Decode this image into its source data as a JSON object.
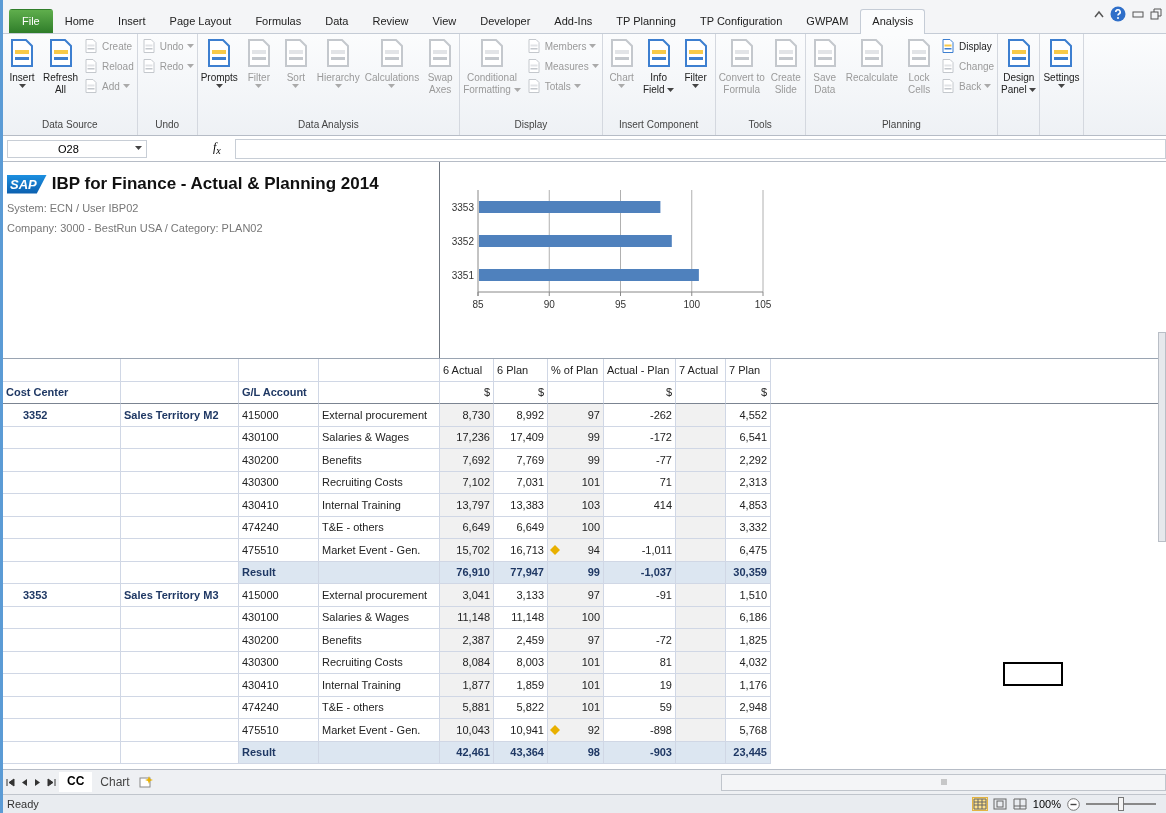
{
  "menu_tabs": [
    {
      "label": "File",
      "kind": "file",
      "selected": false
    },
    {
      "label": "Home",
      "kind": "tab",
      "selected": false
    },
    {
      "label": "Insert",
      "kind": "tab",
      "selected": false
    },
    {
      "label": "Page Layout",
      "kind": "tab",
      "selected": false
    },
    {
      "label": "Formulas",
      "kind": "tab",
      "selected": false
    },
    {
      "label": "Data",
      "kind": "tab",
      "selected": false
    },
    {
      "label": "Review",
      "kind": "tab",
      "selected": false
    },
    {
      "label": "View",
      "kind": "tab",
      "selected": false
    },
    {
      "label": "Developer",
      "kind": "tab",
      "selected": false
    },
    {
      "label": "Add-Ins",
      "kind": "tab",
      "selected": false
    },
    {
      "label": "TP Planning",
      "kind": "tab",
      "selected": false
    },
    {
      "label": "TP Configuration",
      "kind": "tab",
      "selected": false
    },
    {
      "label": "GWPAM",
      "kind": "tab",
      "selected": false
    },
    {
      "label": "Analysis",
      "kind": "tab",
      "selected": true
    }
  ],
  "ribbon": {
    "groups": [
      {
        "label": "Data Source",
        "items": [
          {
            "kind": "large",
            "lines": [
              "Insert"
            ],
            "dropdown": true,
            "disabled": false
          },
          {
            "kind": "large",
            "lines": [
              "Refresh",
              "All"
            ],
            "dropdown": false,
            "disabled": false
          },
          {
            "kind": "stack",
            "items": [
              {
                "label": "Create",
                "dropdown": false,
                "disabled": true
              },
              {
                "label": "Reload",
                "dropdown": false,
                "disabled": true
              },
              {
                "label": "Add",
                "dropdown": true,
                "disabled": true
              }
            ]
          }
        ]
      },
      {
        "label": "Undo",
        "items": [
          {
            "kind": "stack",
            "items": [
              {
                "label": "Undo",
                "dropdown": true,
                "disabled": true
              },
              {
                "label": "Redo",
                "dropdown": true,
                "disabled": true
              }
            ]
          }
        ]
      },
      {
        "label": "Data Analysis",
        "items": [
          {
            "kind": "large",
            "lines": [
              "Prompts"
            ],
            "dropdown": true,
            "disabled": false
          },
          {
            "kind": "large",
            "lines": [
              "Filter"
            ],
            "dropdown": true,
            "disabled": true
          },
          {
            "kind": "large",
            "lines": [
              "Sort"
            ],
            "dropdown": true,
            "disabled": true
          },
          {
            "kind": "large",
            "lines": [
              "Hierarchy"
            ],
            "dropdown": true,
            "disabled": true
          },
          {
            "kind": "large",
            "lines": [
              "Calculations"
            ],
            "dropdown": true,
            "disabled": true
          },
          {
            "kind": "large",
            "lines": [
              "Swap",
              "Axes"
            ],
            "dropdown": false,
            "disabled": true
          }
        ]
      },
      {
        "label": "Display",
        "items": [
          {
            "kind": "large",
            "lines": [
              "Conditional",
              "Formatting"
            ],
            "dropdown": true,
            "disabled": true
          },
          {
            "kind": "stack",
            "items": [
              {
                "label": "Members",
                "dropdown": true,
                "disabled": true
              },
              {
                "label": "Measures",
                "dropdown": true,
                "disabled": true
              },
              {
                "label": "Totals",
                "dropdown": true,
                "disabled": true
              }
            ]
          }
        ]
      },
      {
        "label": "Insert Component",
        "items": [
          {
            "kind": "large",
            "lines": [
              "Chart"
            ],
            "dropdown": true,
            "disabled": true
          },
          {
            "kind": "large",
            "lines": [
              "Info",
              "Field"
            ],
            "dropdown": true,
            "disabled": false
          },
          {
            "kind": "large",
            "lines": [
              "Filter"
            ],
            "dropdown": true,
            "disabled": false
          }
        ]
      },
      {
        "label": "Tools",
        "items": [
          {
            "kind": "large",
            "lines": [
              "Convert to",
              "Formula"
            ],
            "dropdown": false,
            "disabled": true
          },
          {
            "kind": "large",
            "lines": [
              "Create",
              "Slide"
            ],
            "dropdown": false,
            "disabled": true
          }
        ]
      },
      {
        "label": "Planning",
        "items": [
          {
            "kind": "large",
            "lines": [
              "Save",
              "Data"
            ],
            "dropdown": false,
            "disabled": true
          },
          {
            "kind": "large",
            "lines": [
              "Recalculate"
            ],
            "dropdown": false,
            "disabled": true
          },
          {
            "kind": "large",
            "lines": [
              "Lock",
              "Cells"
            ],
            "dropdown": false,
            "disabled": true
          },
          {
            "kind": "stack",
            "items": [
              {
                "label": "Display",
                "dropdown": false,
                "disabled": false
              },
              {
                "label": "Change",
                "dropdown": false,
                "disabled": true
              },
              {
                "label": "Back",
                "dropdown": true,
                "disabled": true
              }
            ]
          }
        ]
      },
      {
        "items": [
          {
            "kind": "large",
            "lines": [
              "Design",
              "Panel"
            ],
            "dropdown": true,
            "disabled": false
          }
        ]
      },
      {
        "items": [
          {
            "kind": "large",
            "lines": [
              "Settings"
            ],
            "dropdown": true,
            "disabled": false
          }
        ]
      }
    ]
  },
  "formula_bar": {
    "name_box": "O28",
    "function_label": "f$_{x}$"
  },
  "report": {
    "logo": "SAP",
    "title": "IBP for Finance - Actual & Planning 2014",
    "lines": [
      "System: ECN / User IBP02",
      "Company: 3000 - BestRun USA / Category: PLAN02"
    ],
    "chart_data": {
      "type": "bar",
      "orientation": "horizontal",
      "categories": [
        "3353",
        "3352",
        "3351"
      ],
      "series": [
        {
          "color": "#4f81bd",
          "values": [
            97.8,
            98.6,
            100.5
          ]
        }
      ],
      "grid": true,
      "xlim": [
        85,
        105
      ],
      "xticks": [
        85,
        90,
        95,
        100,
        105
      ]
    }
  },
  "table": {
    "cost_center_label": "Cost Center",
    "account_label": "G/L Account",
    "columns": [
      {
        "label": "6 Actual",
        "unit": "$"
      },
      {
        "label": "6 Plan",
        "unit": "$"
      },
      {
        "label": "% of Plan"
      },
      {
        "label": "Actual - Plan",
        "unit": "$"
      },
      {
        "label": "7 Actual"
      },
      {
        "label": "7 Plan",
        "unit": "$"
      }
    ],
    "groups": [
      {
        "cost_center": "3352",
        "name": "Sales Territory M2",
        "rows": [
          {
            "account": "415000",
            "description": "External procurement",
            "a6": "8,730",
            "p6": "8,992",
            "pct": "97",
            "diff": "-262",
            "p7": "4,552",
            "alert": false
          },
          {
            "account": "430100",
            "description": "Salaries & Wages",
            "a6": "17,236",
            "p6": "17,409",
            "pct": "99",
            "diff": "-172",
            "p7": "6,541",
            "alert": false
          },
          {
            "account": "430200",
            "description": "Benefits",
            "a6": "7,692",
            "p6": "7,769",
            "pct": "99",
            "diff": "-77",
            "p7": "2,292",
            "alert": false
          },
          {
            "account": "430300",
            "description": "Recruiting Costs",
            "a6": "7,102",
            "p6": "7,031",
            "pct": "101",
            "diff": "71",
            "p7": "2,313",
            "alert": false
          },
          {
            "account": "430410",
            "description": "Internal Training",
            "a6": "13,797",
            "p6": "13,383",
            "pct": "103",
            "diff": "414",
            "p7": "4,853",
            "alert": false
          },
          {
            "account": "474240",
            "description": "T&E - others",
            "a6": "6,649",
            "p6": "6,649",
            "pct": "100",
            "p7": "3,332",
            "alert": false
          },
          {
            "account": "475510",
            "description": "Market Event - Gen.",
            "a6": "15,702",
            "p6": "16,713",
            "pct": "94",
            "diff": "-1,011",
            "p7": "6,475",
            "alert": true
          }
        ],
        "result": {
          "label": "Result",
          "a6": "76,910",
          "p6": "77,947",
          "pct": "99",
          "diff": "-1,037",
          "p7": "30,359"
        }
      },
      {
        "cost_center": "3353",
        "name": "Sales Territory M3",
        "rows": [
          {
            "account": "415000",
            "description": "External procurement",
            "a6": "3,041",
            "p6": "3,133",
            "pct": "97",
            "diff": "-91",
            "p7": "1,510",
            "alert": false
          },
          {
            "account": "430100",
            "description": "Salaries & Wages",
            "a6": "11,148",
            "p6": "11,148",
            "pct": "100",
            "p7": "6,186",
            "alert": false
          },
          {
            "account": "430200",
            "description": "Benefits",
            "a6": "2,387",
            "p6": "2,459",
            "pct": "97",
            "diff": "-72",
            "p7": "1,825",
            "alert": false
          },
          {
            "account": "430300",
            "description": "Recruiting Costs",
            "a6": "8,084",
            "p6": "8,003",
            "pct": "101",
            "diff": "81",
            "p7": "4,032",
            "alert": false
          },
          {
            "account": "430410",
            "description": "Internal Training",
            "a6": "1,877",
            "p6": "1,859",
            "pct": "101",
            "diff": "19",
            "p7": "1,176",
            "alert": false
          },
          {
            "account": "474240",
            "description": "T&E - others",
            "a6": "5,881",
            "p6": "5,822",
            "pct": "101",
            "diff": "59",
            "p7": "2,948",
            "alert": false
          },
          {
            "account": "475510",
            "description": "Market Event - Gen.",
            "a6": "10,043",
            "p6": "10,941",
            "pct": "92",
            "diff": "-898",
            "p7": "5,768",
            "alert": true
          }
        ],
        "result": {
          "label": "Result",
          "a6": "42,461",
          "p6": "43,364",
          "pct": "98",
          "diff": "-903",
          "p7": "23,445"
        }
      }
    ]
  },
  "sheet_tabs": [
    {
      "label": "CC",
      "selected": true
    },
    {
      "label": "Chart",
      "selected": false
    }
  ],
  "status_bar": {
    "text": "Ready",
    "zoom": "100%",
    "zoom_slider": {
      "level": 0.5
    }
  }
}
